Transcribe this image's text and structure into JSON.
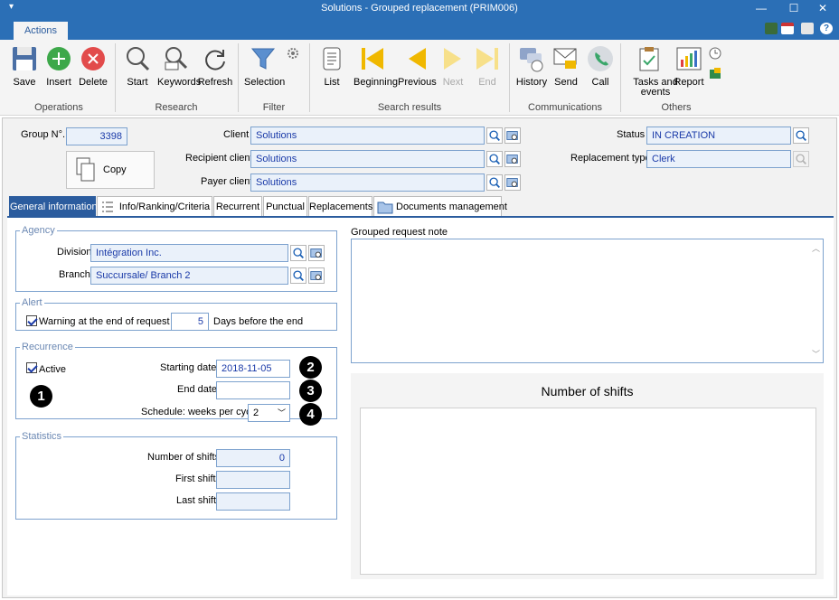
{
  "window": {
    "title": "Solutions - Grouped replacement (PRIM006)"
  },
  "ribbon": {
    "tab": "Actions",
    "groups": [
      "Operations",
      "Research",
      "Filter",
      "Search results",
      "Communications",
      "Others"
    ],
    "buttons": {
      "save": "Save",
      "insert": "Insert",
      "delete": "Delete",
      "start": "Start",
      "keywords": "Keywords",
      "refresh": "Refresh",
      "selection": "Selection",
      "list": "List",
      "beginning": "Beginning",
      "previous": "Previous",
      "next": "Next",
      "end": "End",
      "history": "History",
      "send": "Send",
      "call": "Call",
      "tasks": "Tasks and events",
      "report": "Report"
    }
  },
  "header": {
    "group_no_label": "Group N°.",
    "group_no": "3398",
    "copy_label": "Copy",
    "client_label": "Client",
    "client": "Solutions",
    "recipient_label": "Recipient client",
    "recipient": "Solutions",
    "payer_label": "Payer client",
    "payer": "Solutions",
    "status_label": "Status",
    "status": "IN CREATION",
    "replacement_type_label": "Replacement type",
    "replacement_type": "Clerk"
  },
  "tabs": [
    "General information",
    "Info/Ranking/Criteria",
    "Recurrent",
    "Punctual",
    "Replacements",
    "Documents management"
  ],
  "agency": {
    "legend": "Agency",
    "division_label": "Division",
    "division": "Intégration Inc.",
    "branch_label": "Branch",
    "branch": "Succursale/ Branch 2"
  },
  "alert": {
    "legend": "Alert",
    "warning_label": "Warning at the end of request",
    "days": "5",
    "days_label": "Days before the end"
  },
  "recurrence": {
    "legend": "Recurrence",
    "active_label": "Active",
    "starting_date_label": "Starting date",
    "starting_date": "2018-11-05",
    "end_date_label": "End date",
    "end_date": "",
    "schedule_label": "Schedule: weeks per cycle",
    "schedule": "2"
  },
  "statistics": {
    "legend": "Statistics",
    "shifts_label": "Number of shifts",
    "shifts": "0",
    "first_label": "First shift",
    "first": "",
    "last_label": "Last shift",
    "last": ""
  },
  "note": {
    "label": "Grouped request note"
  },
  "chart": {
    "title": "Number of shifts"
  },
  "callouts": [
    "1",
    "2",
    "3",
    "4"
  ]
}
